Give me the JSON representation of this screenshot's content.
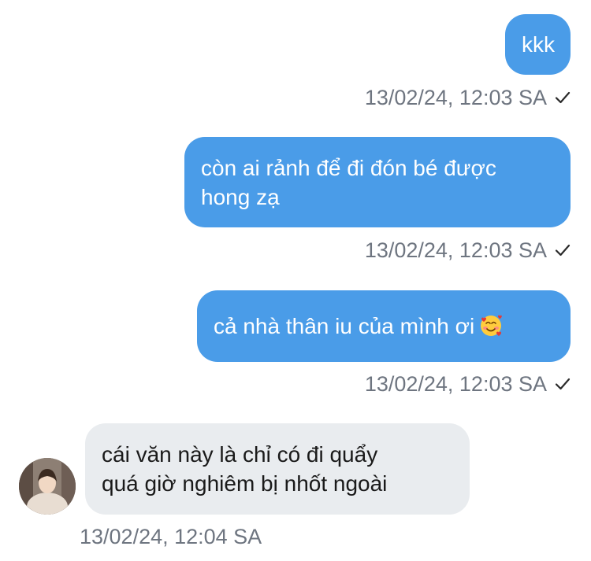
{
  "messages": [
    {
      "direction": "outgoing",
      "text": "kkk",
      "time": "13/02/24, 12:03 SA",
      "status_icon": "check-icon"
    },
    {
      "direction": "outgoing",
      "text": "còn ai rảnh để đi đón bé được\nhong zạ",
      "time": "13/02/24, 12:03 SA",
      "status_icon": "check-icon"
    },
    {
      "direction": "outgoing",
      "text": "cả nhà thân iu của mình ơi",
      "emoji": "smiling-face-with-hearts",
      "time": "13/02/24, 12:03 SA",
      "status_icon": "check-icon"
    },
    {
      "direction": "incoming",
      "text": "cái văn này là chỉ có đi quẩy\nquá giờ nghiêm bị nhốt ngoài",
      "time": "13/02/24, 12:04 SA",
      "avatar": "contact-avatar"
    }
  ],
  "colors": {
    "outgoing_bubble": "#4a9ce8",
    "incoming_bubble": "#e9ecef",
    "timestamp": "#6e7580"
  }
}
